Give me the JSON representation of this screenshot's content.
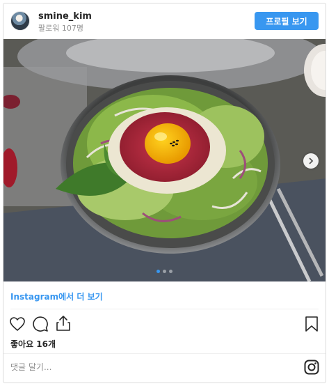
{
  "post": {
    "username": "smine_kim",
    "followers": "팔로워 107명",
    "profile_button": "프로필 보기",
    "more_link": "Instagram에서 더 보기",
    "likes": "좋아요 16개",
    "comment_placeholder": "댓글 달기..."
  },
  "carousel": {
    "current_slide": 1,
    "total_slides": 3
  },
  "icons": [
    "heart-icon",
    "comment-icon",
    "share-icon",
    "bookmark-icon",
    "instagram-logo-icon",
    "chevron-right-icon"
  ],
  "colors": {
    "accent": "#3897f0",
    "text": "#262626",
    "muted": "#8e8e8e",
    "border": "#dbdbdb"
  }
}
